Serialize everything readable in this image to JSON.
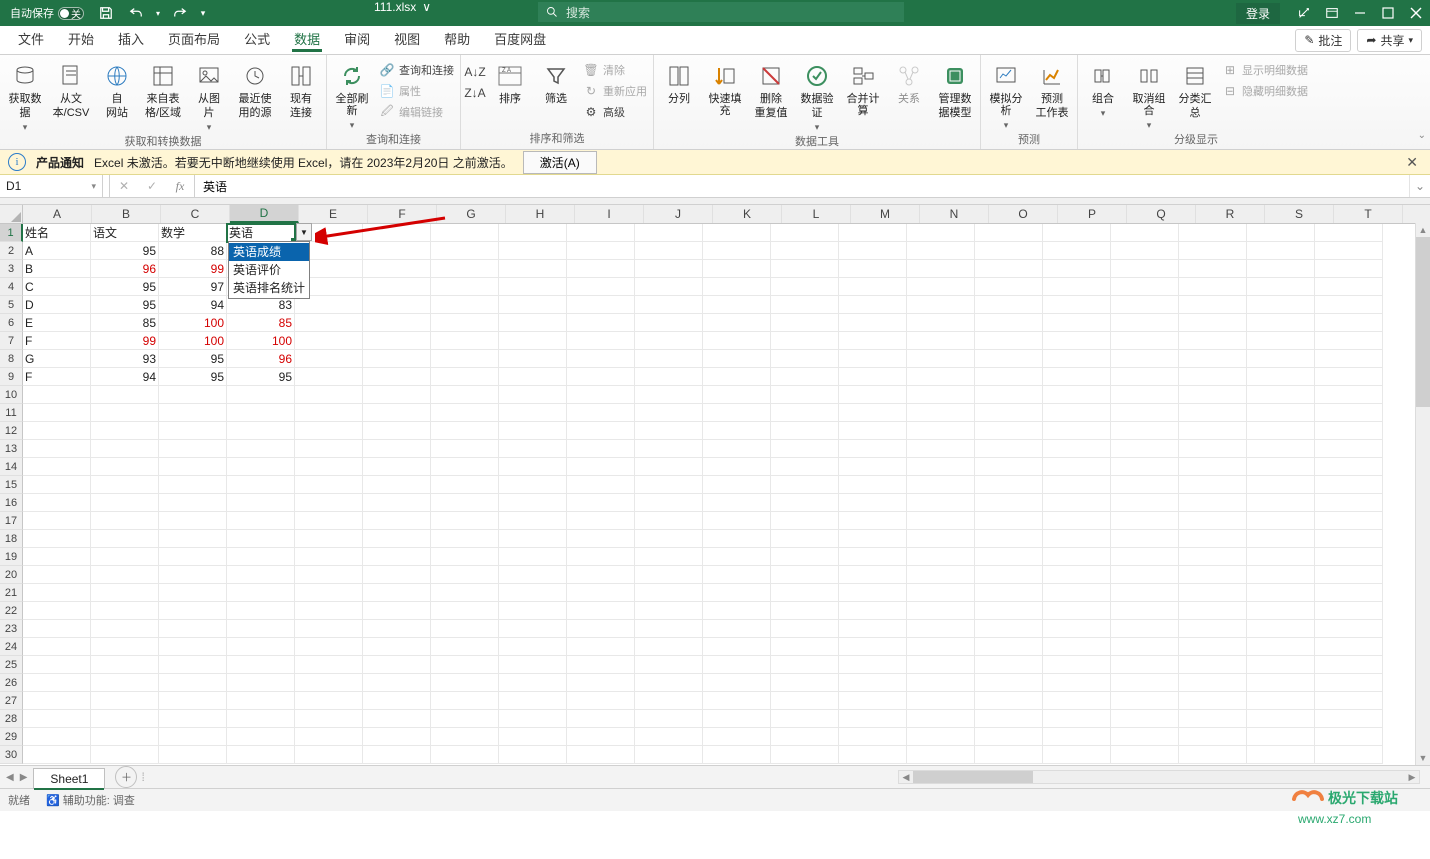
{
  "titlebar": {
    "autosave_label": "自动保存",
    "autosave_off_text": "关",
    "filename": "111.xlsx",
    "search_placeholder": "搜索",
    "login_label": "登录"
  },
  "ribbon_tabs": {
    "items": [
      "文件",
      "开始",
      "插入",
      "页面布局",
      "公式",
      "数据",
      "审阅",
      "视图",
      "帮助",
      "百度网盘"
    ],
    "active_index": 5,
    "comment_btn": "批注",
    "share_btn": "共享"
  },
  "ribbon_groups": {
    "get_data": {
      "label": "获取和转换数据",
      "buttons": [
        "获取数\n据",
        "从文\n本/CSV",
        "自\n网站",
        "来自表\n格/区域",
        "从图\n片",
        "最近使\n用的源",
        "现有\n连接"
      ]
    },
    "queries": {
      "label": "查询和连接",
      "refresh_btn": "全部刷\n新",
      "items": [
        "查询和连接",
        "属性",
        "编辑链接"
      ]
    },
    "sort_filter": {
      "label": "排序和筛选",
      "sort_btn": "排序",
      "filter_btn": "筛选",
      "items": [
        "清除",
        "重新应用",
        "高级"
      ]
    },
    "data_tools": {
      "label": "数据工具",
      "buttons": [
        "分列",
        "快速填充",
        "删除\n重复值",
        "数据验\n证",
        "合并计算",
        "关系",
        "管理数\n据模型"
      ]
    },
    "forecast": {
      "label": "预测",
      "buttons": [
        "模拟分析",
        "预测\n工作表"
      ]
    },
    "outline": {
      "label": "分级显示",
      "buttons": [
        "组合",
        "取消组合",
        "分类汇\n总"
      ],
      "show_detail": "显示明细数据",
      "hide_detail": "隐藏明细数据"
    }
  },
  "banner": {
    "title": "产品通知",
    "text": "Excel 未激活。若要无中断地继续使用 Excel，请在 2023年2月20日 之前激活。",
    "button": "激活(A)"
  },
  "formula_bar": {
    "name_box": "D1",
    "value": "英语"
  },
  "grid": {
    "columns": [
      "A",
      "B",
      "C",
      "D",
      "E",
      "F",
      "G",
      "H",
      "I",
      "J",
      "K",
      "L",
      "M",
      "N",
      "O",
      "P",
      "Q",
      "R",
      "S",
      "T"
    ],
    "row_count": 30,
    "header_row": [
      "姓名",
      "语文",
      "数学",
      "英语"
    ],
    "data_rows": [
      {
        "n": "A",
        "v": [
          95,
          88,
          null
        ]
      },
      {
        "n": "B",
        "v": [
          96,
          99,
          null
        ]
      },
      {
        "n": "C",
        "v": [
          95,
          97,
          null
        ]
      },
      {
        "n": "D",
        "v": [
          95,
          94,
          83
        ]
      },
      {
        "n": "E",
        "v": [
          85,
          100,
          85
        ]
      },
      {
        "n": "F",
        "v": [
          99,
          100,
          100
        ]
      },
      {
        "n": "G",
        "v": [
          93,
          95,
          96
        ]
      },
      {
        "n": "F",
        "v": [
          94,
          95,
          95
        ]
      }
    ],
    "red_cells": [
      [
        3,
        2
      ],
      [
        3,
        3
      ],
      [
        6,
        3
      ],
      [
        6,
        4
      ],
      [
        7,
        2
      ],
      [
        7,
        3
      ],
      [
        7,
        4
      ],
      [
        8,
        4
      ]
    ],
    "selected": {
      "row": 1,
      "col": 4
    }
  },
  "dropdown": {
    "items": [
      "英语成绩",
      "英语评价",
      "英语排名统计"
    ],
    "selected_index": 0
  },
  "sheet_tabs": {
    "active": "Sheet1"
  },
  "status_bar": {
    "ready": "就绪",
    "access": "辅助功能: 调查"
  },
  "watermark": {
    "text1": "极光下载站",
    "text2": "www.xz7.com"
  }
}
